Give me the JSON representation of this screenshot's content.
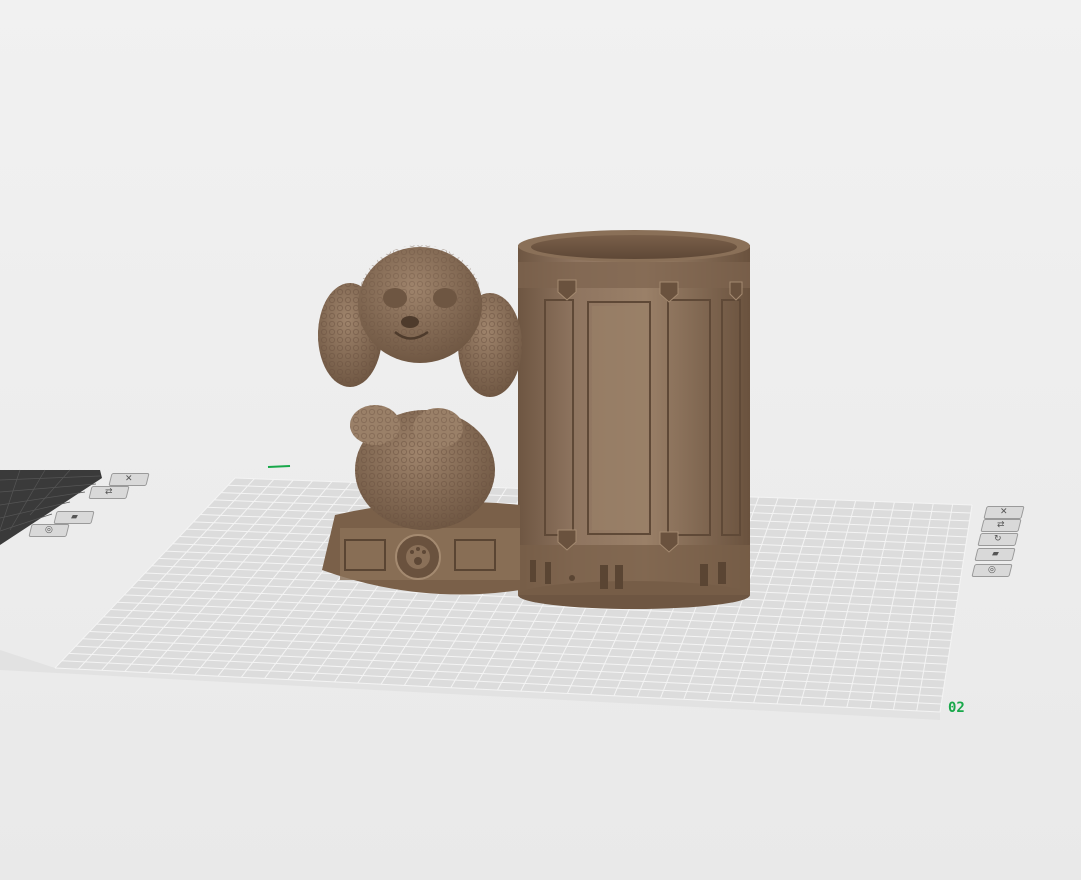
{
  "scene": {
    "plate_main": {
      "label": "02"
    },
    "plate_left": {
      "label": ""
    },
    "plate_tools": [
      {
        "name": "close-icon",
        "glyph": "✕"
      },
      {
        "name": "arrange-icon",
        "glyph": "⇄"
      },
      {
        "name": "rotate-icon",
        "glyph": "↻"
      },
      {
        "name": "lock-icon",
        "glyph": "▰"
      },
      {
        "name": "settings-icon",
        "glyph": "◎"
      }
    ],
    "left_plate_tools": [
      {
        "name": "close-icon",
        "glyph": "✕"
      },
      {
        "name": "arrange-icon",
        "glyph": "⇄"
      },
      {
        "name": "lock-icon",
        "glyph": "▰"
      },
      {
        "name": "settings-icon",
        "glyph": "◎"
      }
    ],
    "colors": {
      "background": "#ececec",
      "plate_grid": "#c8c8c8",
      "plate_fill": "#dcdcdc",
      "model": "#8a7058",
      "model_shadow": "#6e5642",
      "model_highlight": "#a48a70",
      "label_green": "#18a84a",
      "dark_plate": "#3a3a3a"
    }
  }
}
